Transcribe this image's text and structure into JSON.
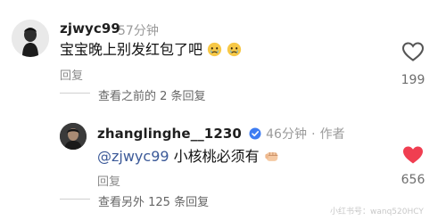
{
  "comments": [
    {
      "username": "zjwyc99",
      "time": "57分钟",
      "text": "宝宝晚上别发红包了吧",
      "emojis": [
        "crying-face",
        "crying-face"
      ],
      "reply_label": "回复",
      "likes": "199",
      "liked": false,
      "view_previous": "查看之前的 2 条回复"
    },
    {
      "username": "zhanglinghe__1230",
      "verified": true,
      "time": "46分钟",
      "separator": "·",
      "author_tag": "作者",
      "mention": "@zjwyc99",
      "text": "小核桃必须有",
      "emoji": "fist",
      "reply_label": "回复",
      "likes": "656",
      "liked": true,
      "view_more": "查看另外 125 条回复"
    }
  ],
  "watermark": "小红书号：wanq520HCY",
  "colors": {
    "liked_heart": "#f03e51",
    "verified_badge": "#3d7cf2",
    "mention": "#3b5998"
  }
}
